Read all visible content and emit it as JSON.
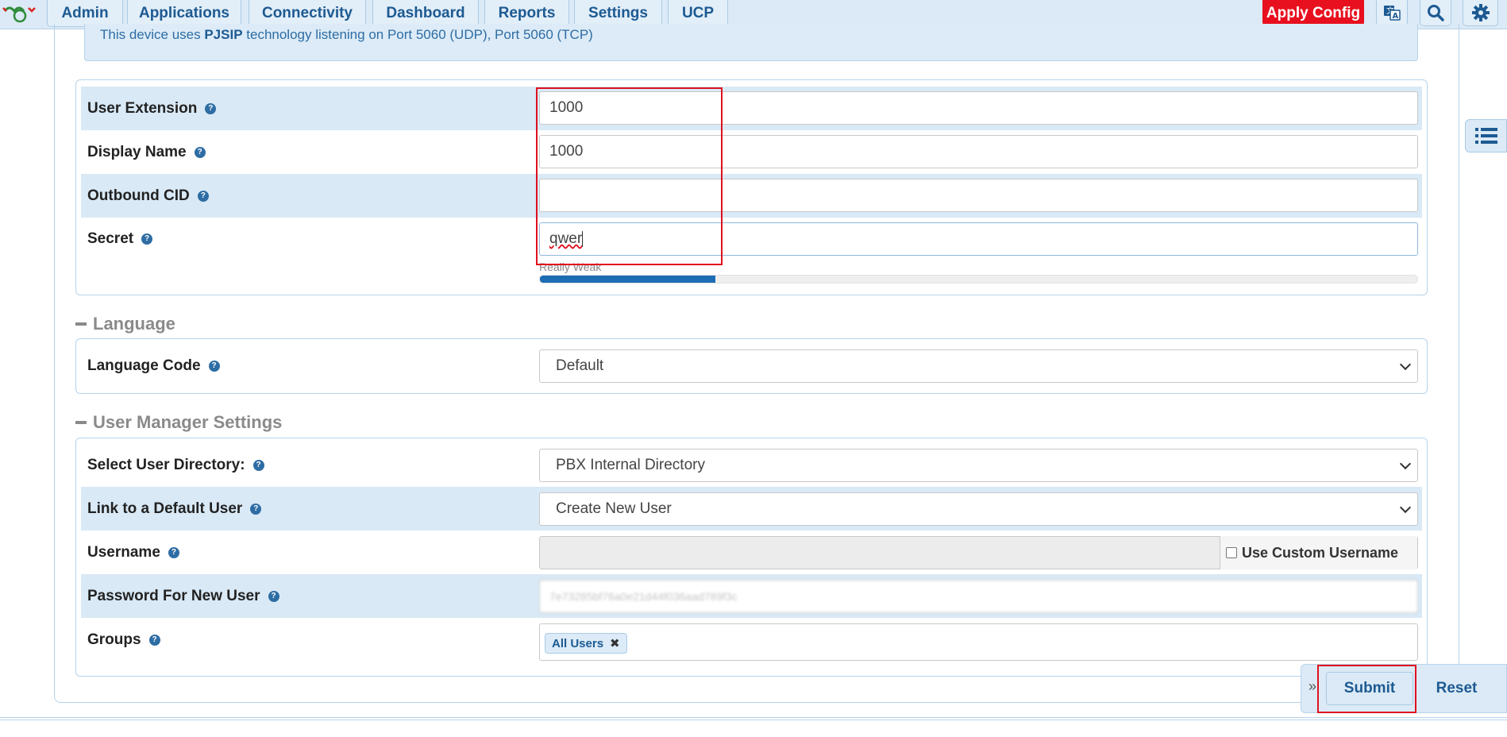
{
  "nav": {
    "items": [
      {
        "label": "Admin"
      },
      {
        "label": "Applications"
      },
      {
        "label": "Connectivity"
      },
      {
        "label": "Dashboard"
      },
      {
        "label": "Reports"
      },
      {
        "label": "Settings"
      },
      {
        "label": "UCP"
      }
    ],
    "apply_label": "Apply Config",
    "icons": [
      "translate-icon",
      "search-icon",
      "gear-icon"
    ]
  },
  "info": {
    "prefix": "This device uses ",
    "tech": "PJSIP",
    "suffix": " technology listening on Port 5060 (UDP), Port 5060 (TCP)"
  },
  "general": {
    "user_extension": {
      "label": "User Extension",
      "value": "1000"
    },
    "display_name": {
      "label": "Display Name",
      "value": "1000"
    },
    "outbound_cid": {
      "label": "Outbound CID",
      "value": ""
    },
    "secret": {
      "label": "Secret",
      "value": "qwer",
      "strength_label": "Really Weak",
      "strength_pct": 20
    }
  },
  "language": {
    "title": "Language",
    "language_code": {
      "label": "Language Code",
      "value": "Default"
    }
  },
  "user_manager": {
    "title": "User Manager Settings",
    "directory": {
      "label": "Select User Directory:",
      "value": "PBX Internal Directory"
    },
    "default_user": {
      "label": "Link to a Default User",
      "value": "Create New User"
    },
    "username": {
      "label": "Username",
      "value": "",
      "custom_label": "Use Custom Username"
    },
    "password": {
      "label": "Password For New User",
      "value": "7e73285bf76a0e21d44f036aad789f3c"
    },
    "groups": {
      "label": "Groups",
      "tags": [
        "All Users"
      ]
    }
  },
  "actions": {
    "submit": "Submit",
    "reset": "Reset",
    "collapse": "»"
  },
  "colors": {
    "accent": "#1d5a92",
    "apply": "#e8101e",
    "panel": "#dbeaf6",
    "highlight_box": "#e0101e"
  }
}
